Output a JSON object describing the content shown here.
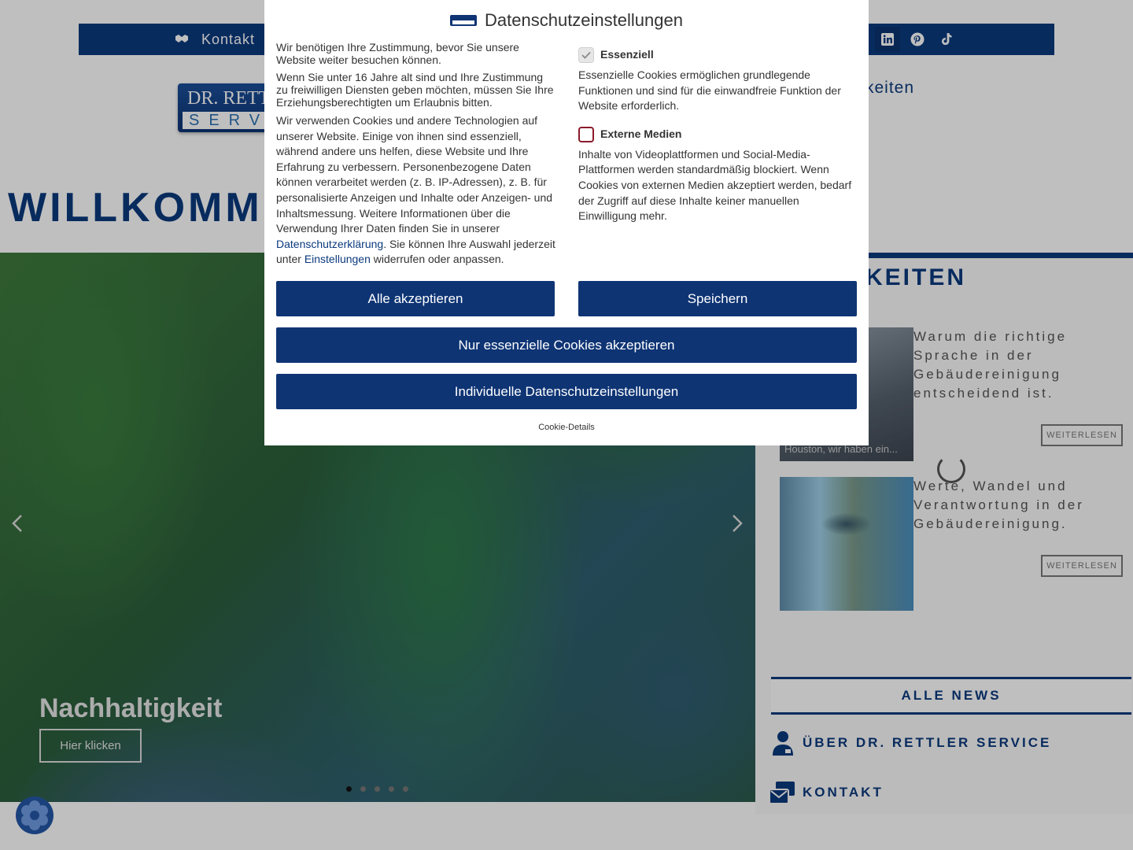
{
  "topbar": {
    "contact_label": "Kontakt",
    "social_icons": [
      "linkedin-icon",
      "pinterest-icon",
      "tiktok-icon"
    ]
  },
  "header": {
    "logo_line1": "DR. RETTL",
    "logo_line2": "SERVI",
    "menu_right": "keiten"
  },
  "welcome": "WILLKOMME",
  "slider": {
    "title": "Nachhaltigkeit",
    "button": "Hier klicken",
    "dots": 5,
    "active_dot": 1
  },
  "news": {
    "heading": "KEITEN",
    "items": [
      {
        "title": "Warum die richtige Sprache in der Gebäudereinigung entscheidend ist.",
        "caption": "Houston, wir haben ein...",
        "more": "WEITERLESEN"
      },
      {
        "title": "Werte, Wandel und Verantwortung in der Gebäudereinigung.",
        "caption": "",
        "more": "WEITERLESEN"
      }
    ],
    "all_news": "ALLE NEWS",
    "links": [
      {
        "label": "ÜBER DR. RETTLER SERVICE",
        "icon": "person-icon"
      },
      {
        "label": "KONTAKT",
        "icon": "contact-card-icon"
      }
    ]
  },
  "dialog": {
    "title": "Datenschutzeinstellungen",
    "p1": "Wir benötigen Ihre Zustimmung, bevor Sie unsere Website weiter besuchen können.",
    "p2": "Wenn Sie unter 16 Jahre alt sind und Ihre Zustimmung zu freiwilligen Diensten geben möchten, müssen Sie Ihre Erziehungsberechtigten um Erlaubnis bitten.",
    "p3_start": "Wir verwenden Cookies und andere Technologien auf unserer Website. Einige von ihnen sind essenziell, während andere uns helfen, diese Website und Ihre Erfahrung zu verbessern. Personenbezogene Daten können verarbeitet werden (z. B. IP-Adressen), z. B. für personalisierte Anzeigen und Inhalte oder Anzeigen- und Inhaltsmessung. Weitere Informationen über die Verwendung Ihrer Daten finden Sie in unserer ",
    "privacy_link": "Datenschutzerklärung",
    "p3_mid": ". Sie können Ihre Auswahl jederzeit unter ",
    "settings_link": "Einstellungen",
    "p3_end": " widerrufen oder anpassen.",
    "essential_label": "Essenziell",
    "essential_desc": "Essenzielle Cookies ermöglichen grundlegende Funktionen und sind für die einwandfreie Funktion der Website erforderlich.",
    "external_label": "Externe Medien",
    "external_desc": "Inhalte von Videoplattformen und Social-Media-Plattformen werden standardmäßig blockiert. Wenn Cookies von externen Medien akzeptiert werden, bedarf der Zugriff auf diese Inhalte keiner manuellen Einwilligung mehr.",
    "accept_all": "Alle akzeptieren",
    "save": "Speichern",
    "only_essential": "Nur essenzielle Cookies akzeptieren",
    "individual": "Individuelle Datenschutzeinstellungen",
    "details_link": "Cookie-Details",
    "essential_checked": true,
    "external_checked": false
  },
  "colors": {
    "brand": "#0b3a7e",
    "button": "#0e3474",
    "checkbox_border": "#8b1a2b"
  }
}
